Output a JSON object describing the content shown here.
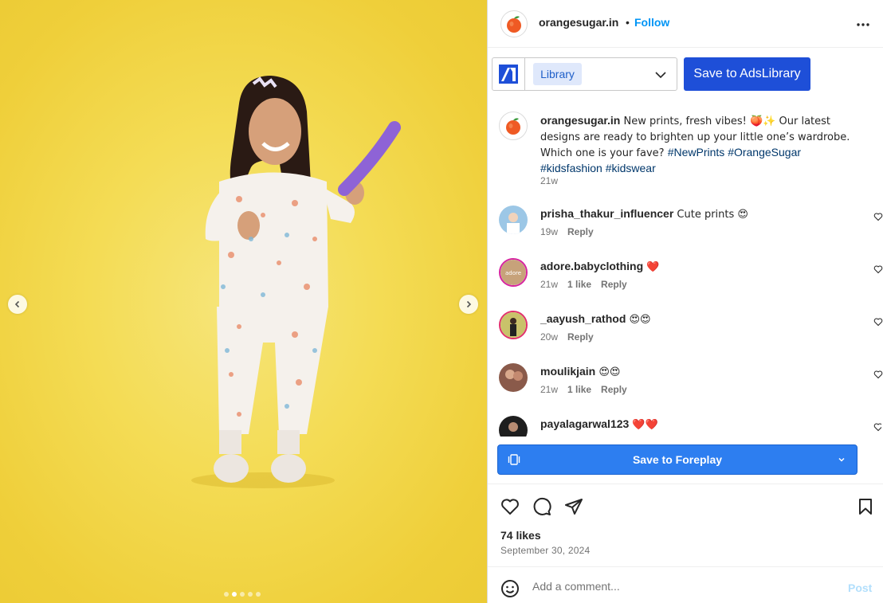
{
  "post": {
    "username": "orangesugar.in",
    "separator": "•",
    "follow_label": "Follow"
  },
  "adslibrary": {
    "selected_board": "Library",
    "save_label": "Save to AdsLibrary"
  },
  "caption": {
    "username": "orangesugar.in",
    "text": " New prints, fresh vibes! 🍑✨ Our latest designs are ready to brighten up your little one’s wardrobe. Which one is your fave? ",
    "hashtags": [
      "#NewPrints",
      "#OrangeSugar",
      "#kidsfashion",
      "#kidswear"
    ],
    "time": "21w"
  },
  "comments": [
    {
      "username": "prisha_thakur_influencer",
      "text": " Cute prints 😍",
      "time": "19w",
      "likes": "",
      "reply": "Reply"
    },
    {
      "username": "adore.babyclothing",
      "text": " ❤️",
      "time": "21w",
      "likes": "1 like",
      "reply": "Reply",
      "avatar_text": "adore"
    },
    {
      "username": "_aayush_rathod",
      "text": " 😍😍",
      "time": "20w",
      "likes": "",
      "reply": "Reply"
    },
    {
      "username": "moulikjain",
      "text": " 😍😍",
      "time": "21w",
      "likes": "1 like",
      "reply": "Reply"
    },
    {
      "username": "payalagarwal123",
      "text": " ❤️❤️",
      "time": "",
      "likes": "",
      "reply": ""
    }
  ],
  "foreplay": {
    "label": "Save to Foreplay"
  },
  "stats": {
    "likes": "74 likes",
    "date": "September 30, 2024"
  },
  "comment_box": {
    "placeholder": "Add a comment...",
    "post_label": "Post"
  },
  "carousel": {
    "total": 5,
    "active_index": 1
  },
  "colors": {
    "link_blue": "#0095f6",
    "adslibrary_button": "#1e4fd8",
    "foreplay_button": "#2d7ef0",
    "hashtag": "#00376b",
    "media_background": "#f4dc55"
  }
}
